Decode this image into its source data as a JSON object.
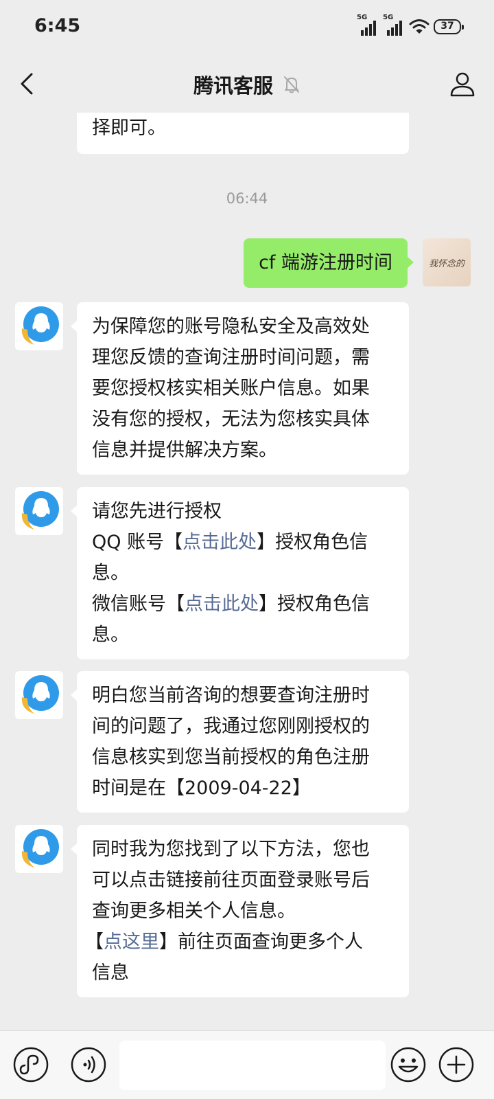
{
  "status": {
    "time": "6:45",
    "sim1": "5G",
    "sim2": "5G",
    "battery": "37"
  },
  "nav": {
    "title": "腾讯客服"
  },
  "messages": {
    "partial_top": [
      "择即可。"
    ],
    "timestamp": "06:44",
    "user_msg": "cf 端游注册时间",
    "user_avatar_text": "我怀念的",
    "msg1": [
      "为保障您的账号隐私安全及高效处",
      "理您反馈的查询注册时间问题，需",
      "要您授权核实相关账户信息。如果",
      "没有您的授权，无法为您核实具体",
      "信息并提供解决方案。"
    ],
    "msg2": {
      "line1": "请您先进行授权",
      "qq_prefix": "QQ 账号【",
      "qq_link": "点击此处",
      "qq_suffix": "】授权角色信",
      "qq_tail": "息。",
      "wx_prefix": "微信账号【",
      "wx_link": "点击此处",
      "wx_suffix": "】授权角色信",
      "wx_tail": "息。"
    },
    "msg3": [
      "明白您当前咨询的想要查询注册时",
      "间的问题了，我通过您刚刚授权的",
      "信息核实到您当前授权的角色注册",
      "时间是在【2009-04-22】"
    ],
    "msg4": {
      "lines": [
        "同时我为您找到了以下方法，您也",
        "可以点击链接前往页面登录账号后",
        "查询更多相关个人信息。"
      ],
      "link_prefix": "【",
      "link": "点这里",
      "link_suffix": "】前往页面查询更多个人",
      "tail": "信息"
    }
  },
  "input": {
    "value": ""
  },
  "icons": {
    "back": "chevron-left-icon",
    "mute": "bell-off-icon",
    "profile": "person-icon",
    "mini_program": "mini-program-icon",
    "voice": "voice-icon",
    "emoji": "emoji-icon",
    "more": "plus-icon"
  },
  "colors": {
    "user_bubble": "#95ec69",
    "link": "#576b95",
    "background": "#ededed"
  }
}
